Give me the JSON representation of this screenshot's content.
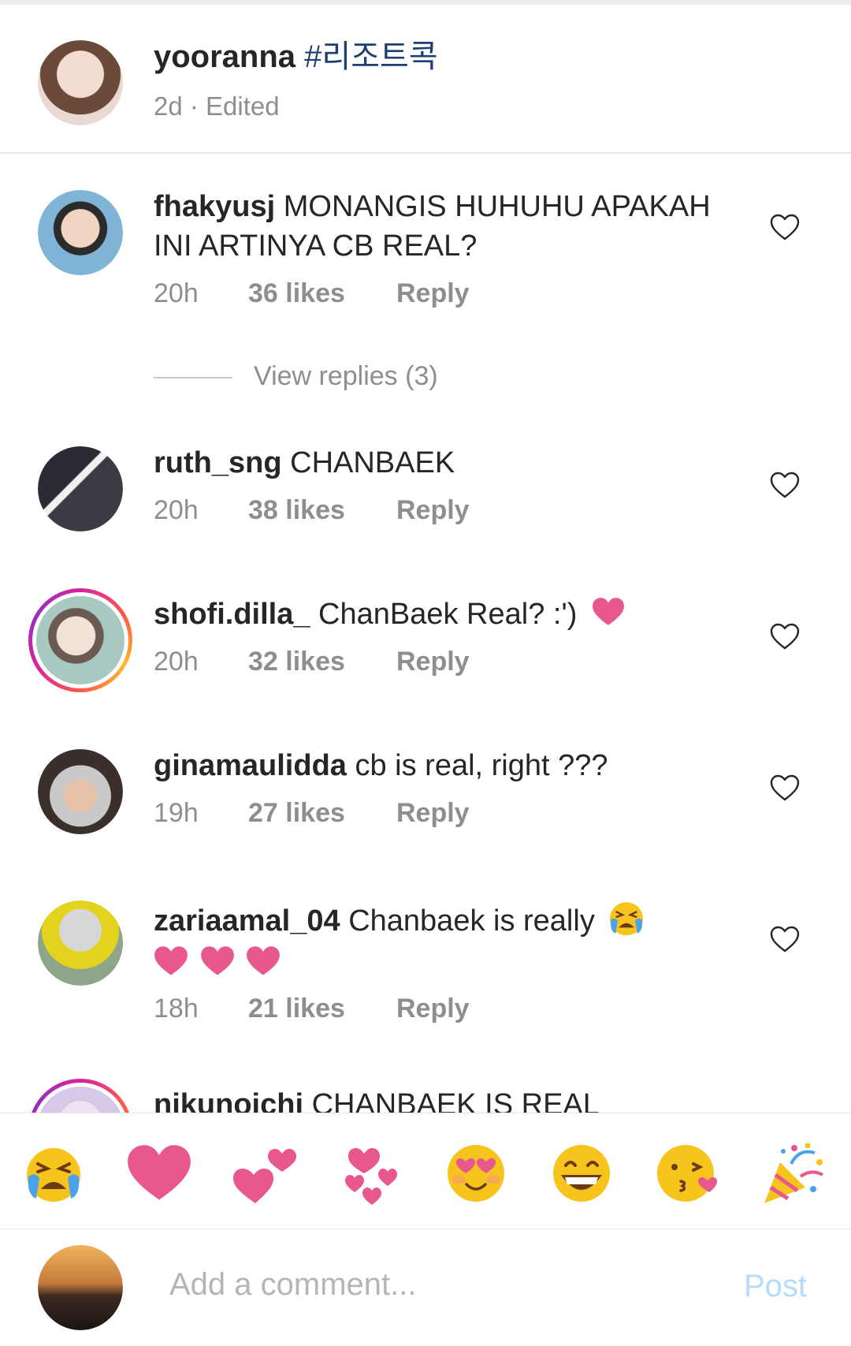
{
  "post": {
    "username": "yooranna",
    "hashtag": "#리조트콕",
    "meta": "2d · Edited"
  },
  "comments": [
    {
      "username": "fhakyusj",
      "text": "MONANGIS HUHUHU APAKAH INI ARTINYA CB REAL?",
      "time": "20h",
      "likes": "36 likes",
      "reply": "Reply",
      "avatar_color": "#7fb4d6"
    },
    {
      "username": "ruth_sng",
      "text": "CHANBAEK",
      "time": "20h",
      "likes": "38 likes",
      "reply": "Reply",
      "avatar_color": "#3b3b44"
    },
    {
      "username": "shofi.dilla_",
      "text": "ChanBaek Real? :')",
      "time": "20h",
      "likes": "32 likes",
      "reply": "Reply",
      "avatar_color": "#a8c9c2",
      "story_ring": true,
      "trailing_emoji": "heart"
    },
    {
      "username": "ginamaulidda",
      "text": "cb is real, right ???",
      "time": "19h",
      "likes": "27 likes",
      "reply": "Reply",
      "avatar_color": "#5a4a44"
    },
    {
      "username": "zariaamal_04",
      "text": "Chanbaek is really",
      "time": "18h",
      "likes": "21 likes",
      "reply": "Reply",
      "avatar_color": "#8ea58a",
      "trailing_emoji": "crying-face",
      "second_line_emoji": [
        "heart",
        "heart",
        "heart"
      ]
    },
    {
      "username": "nikunoichi",
      "text": "CHANBAEK IS REAL",
      "avatar_color": "#d8c8e8",
      "story_ring": true
    }
  ],
  "view_replies": "View replies (3)",
  "emoji_bar": [
    "crying-face",
    "heart",
    "two-hearts",
    "revolving-hearts",
    "heart-eyes-face",
    "grinning-face",
    "kissing-face",
    "party-popper"
  ],
  "composer": {
    "placeholder": "Add a comment...",
    "post_label": "Post"
  },
  "colors": {
    "text": "#262626",
    "secondary": "#8e8e8e",
    "hashtag": "#1f3f72",
    "post_disabled": "#b3dbff",
    "heart_emoji": "#e8588e"
  }
}
